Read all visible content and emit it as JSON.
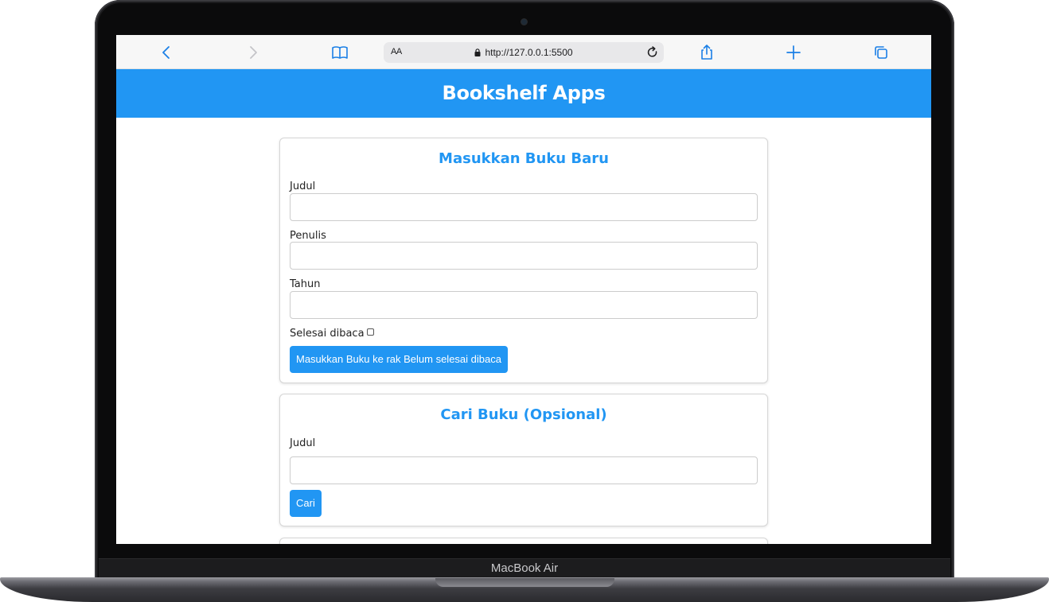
{
  "device": {
    "label": "MacBook Air"
  },
  "browser": {
    "text_size_label": "AA",
    "url": "http://127.0.0.1:5500"
  },
  "app": {
    "title": "Bookshelf Apps"
  },
  "add_form": {
    "heading": "Masukkan Buku Baru",
    "title_label": "Judul",
    "title_value": "",
    "author_label": "Penulis",
    "author_value": "",
    "year_label": "Tahun",
    "year_value": "",
    "complete_label": "Selesai dibaca",
    "complete_checked": false,
    "submit_label": "Masukkan Buku ke rak Belum selesai dibaca"
  },
  "search_form": {
    "heading": "Cari Buku (Opsional)",
    "title_label": "Judul",
    "title_value": "",
    "submit_label": "Cari"
  },
  "colors": {
    "accent": "#2196f3",
    "browser_icon": "#1a7fe6"
  }
}
